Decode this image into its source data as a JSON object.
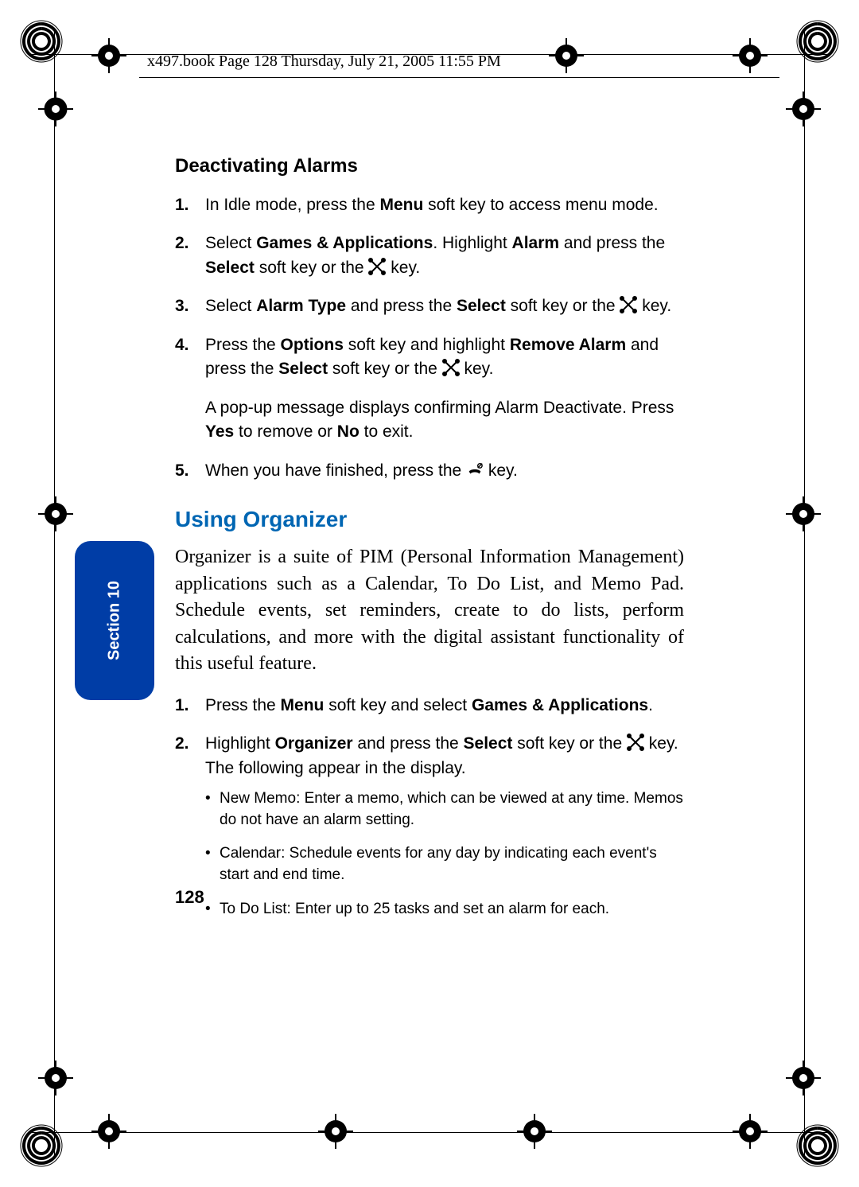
{
  "header": "x497.book  Page 128  Thursday, July 21, 2005  11:55 PM",
  "section_tab": "Section 10",
  "page_number": "128",
  "heading_alarms": "Deactivating Alarms",
  "heading_organizer": "Using Organizer",
  "organizer_intro": "Organizer is a suite of PIM (Personal Information Management) applications such as a Calendar, To Do List, and Memo Pad. Schedule events, set reminders, create to do lists, perform calculations, and more with the digital assistant functionality of this useful feature.",
  "alarms_steps": {
    "s1": "In Idle mode, press the <b>Menu</b> soft key to access menu mode.",
    "s2": "Select <b>Games & Applications</b>. Highlight <b>Alarm</b> and press the <b>Select</b> soft key or the {X} key.",
    "s3": "Select <b>Alarm Type</b> and press the <b>Select</b> soft key or the {X} key.",
    "s4a": "Press the <b>Options</b> soft key and highlight <b>Remove Alarm</b> and press the <b>Select</b> soft key or the {X} key.",
    "s4b": "A pop-up message displays confirming Alarm Deactivate. Press <b>Yes</b> to remove or <b>No</b> to exit.",
    "s5": "When you have finished, press the {END} key."
  },
  "organizer_steps": {
    "s1": "Press the <b>Menu</b> soft key and select <b>Games & Applications</b>.",
    "s2": "Highlight <b>Organizer</b> and press the <b>Select</b> soft key or the {X} key. The following appear in the display."
  },
  "organizer_sub": {
    "i1": "New Memo: Enter a memo, which can be viewed at any time. Memos do not have an alarm setting.",
    "i2": "Calendar: Schedule events for any day by indicating each event's start and end time.",
    "i3": "To Do List: Enter up to 25 tasks and set an alarm for each."
  }
}
